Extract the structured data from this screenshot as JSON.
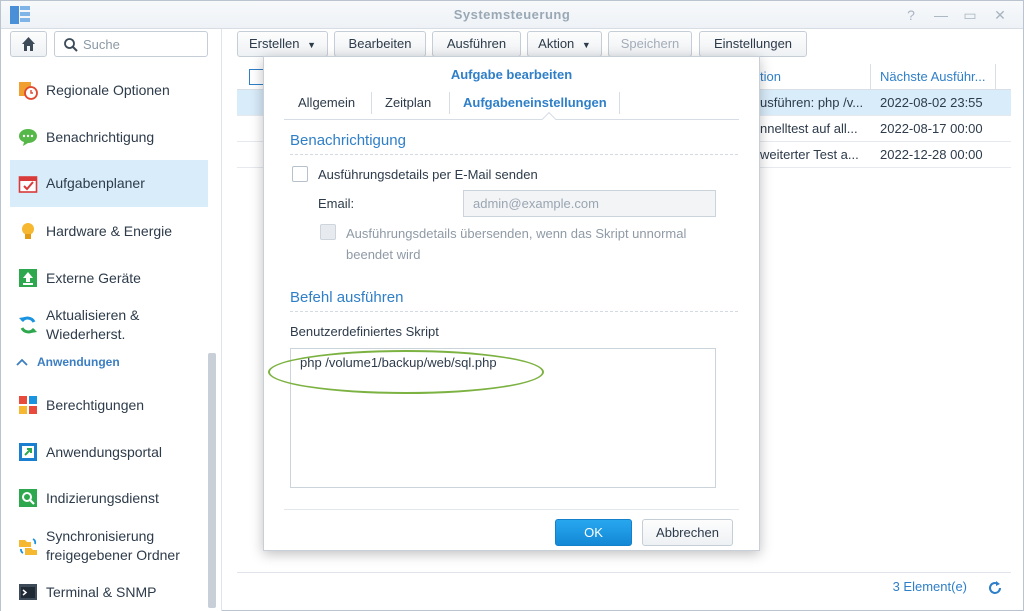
{
  "window": {
    "title": "Systemsteuerung",
    "controls": [
      "?",
      "—",
      "▭",
      "✕"
    ]
  },
  "sidebar": {
    "search_placeholder": "Suche",
    "items": [
      {
        "label": "Regionale Optionen",
        "icon": "clock-map-icon"
      },
      {
        "label": "Benachrichtigung",
        "icon": "chat-bubble-icon"
      },
      {
        "label": "Aufgabenplaner",
        "icon": "calendar-check-icon"
      },
      {
        "label": "Hardware & Energie",
        "icon": "lightbulb-icon"
      },
      {
        "label": "Externe Geräte",
        "icon": "upload-icon"
      },
      {
        "label": "Aktualisieren & Wiederherst.",
        "icon": "refresh-icon"
      }
    ],
    "section": "Anwendungen",
    "app_items": [
      {
        "label": "Berechtigungen",
        "icon": "grid-permissions-icon"
      },
      {
        "label": "Anwendungsportal",
        "icon": "portal-icon"
      },
      {
        "label": "Indizierungsdienst",
        "icon": "search-index-icon"
      },
      {
        "label": "Synchronisierung freigegebener Ordner",
        "icon": "sync-folder-icon"
      },
      {
        "label": "Terminal & SNMP",
        "icon": "terminal-icon"
      }
    ]
  },
  "toolbar": {
    "create": "Erstellen",
    "edit": "Bearbeiten",
    "run": "Ausführen",
    "action": "Aktion",
    "save": "Speichern",
    "settings": "Einstellungen"
  },
  "grid": {
    "headers": {
      "action": "tion",
      "next_run": "Nächste Ausführ..."
    },
    "rows": [
      {
        "action": "usführen: php /v...",
        "next_run": "2022-08-02 23:55"
      },
      {
        "action": "nnelltest auf all...",
        "next_run": "2022-08-17 00:00"
      },
      {
        "action": "weiterter Test a...",
        "next_run": "2022-12-28 00:00"
      }
    ],
    "count": "3 Element(e)"
  },
  "modal": {
    "title": "Aufgabe bearbeiten",
    "tabs": [
      "Allgemein",
      "Zeitplan",
      "Aufgabeneinstellungen"
    ],
    "notification_title": "Benachrichtigung",
    "send_details_label": "Ausführungsdetails per E-Mail senden",
    "email_label": "Email:",
    "email_placeholder": "admin@example.com",
    "abnormal_line1": "Ausführungsdetails übersenden, wenn das Skript unnormal",
    "abnormal_line2": "beendet wird",
    "command_title": "Befehl ausführen",
    "script_label": "Benutzerdefiniertes Skript",
    "script_value": "php /volume1/backup/web/sql.php",
    "ok": "OK",
    "cancel": "Abbrechen"
  },
  "colors": {
    "accent": "#2f7fc8",
    "primary_button": "#1a93e0",
    "highlight": "#7cb241",
    "selection": "#d9ecfa"
  }
}
